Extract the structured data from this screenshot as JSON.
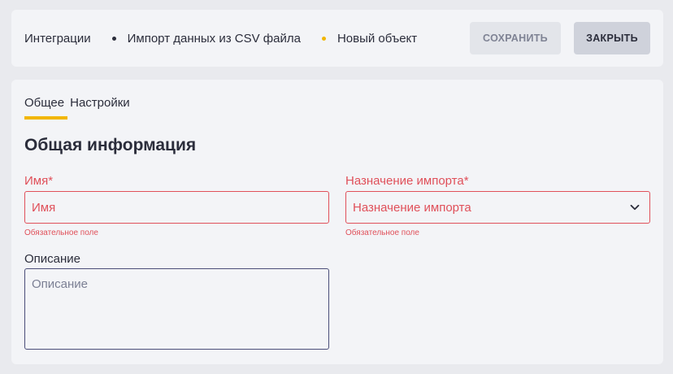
{
  "breadcrumb": {
    "items": [
      "Интеграции",
      "Импорт данных из CSV файла",
      "Новый объект"
    ]
  },
  "toolbar": {
    "save_label": "СОХРАНИТЬ",
    "close_label": "ЗАКРЫТЬ"
  },
  "tabs": [
    "Общее",
    "Настройки"
  ],
  "section_title": "Общая информация",
  "fields": {
    "name": {
      "label": "Имя*",
      "placeholder": "Имя",
      "error": "Обязательное поле"
    },
    "purpose": {
      "label": "Назначение импорта*",
      "placeholder": "Назначение импорта",
      "error": "Обязательное поле"
    },
    "description": {
      "label": "Описание",
      "placeholder": "Описание"
    }
  },
  "colors": {
    "accent": "#f2b600",
    "error": "#e0505a",
    "text": "#2b2d3b"
  },
  "icons": {
    "select_chevron": "chevron-down-icon"
  }
}
